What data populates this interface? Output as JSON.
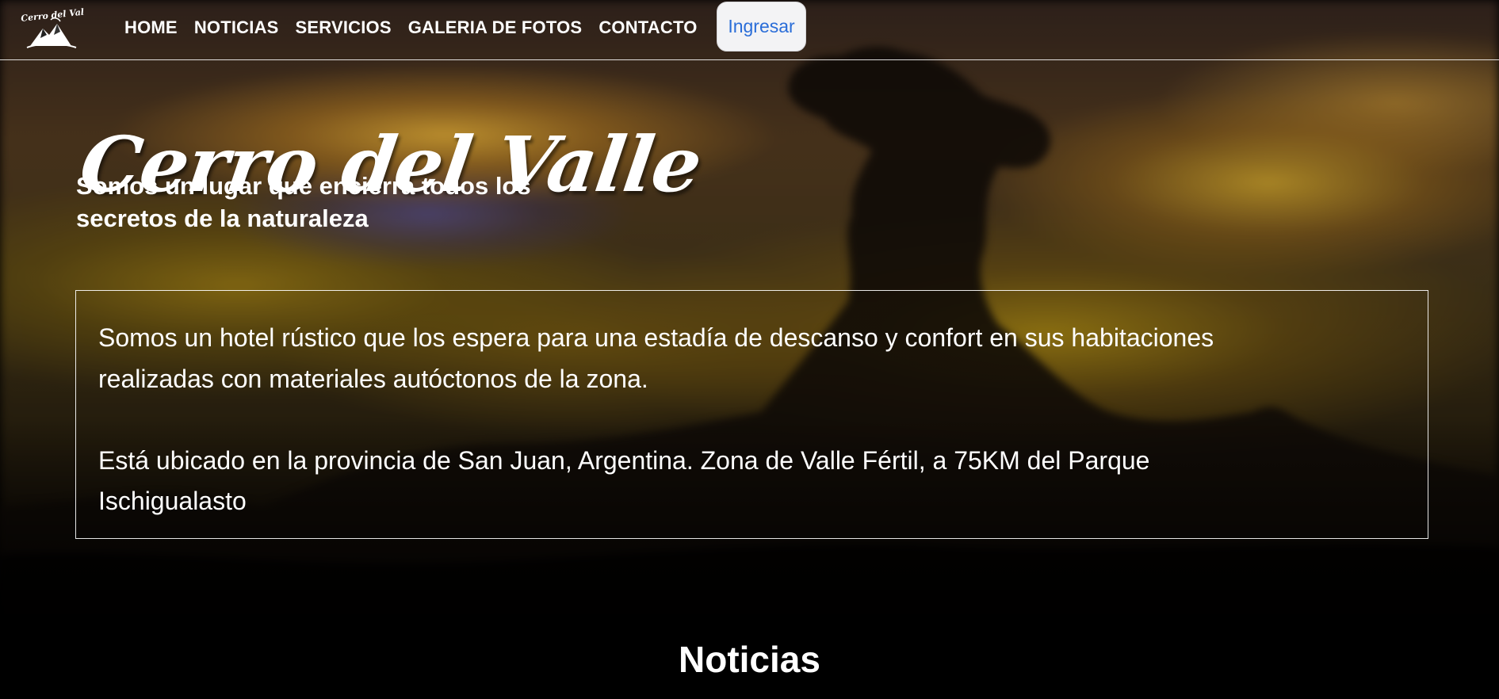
{
  "brand": {
    "logo_text": "Cerro del Valle",
    "logo_icon": "mountain-logo-icon"
  },
  "nav": {
    "items": [
      {
        "label": "HOME"
      },
      {
        "label": "NOTICIAS"
      },
      {
        "label": "SERVICIOS"
      },
      {
        "label": "GALERIA DE FOTOS"
      },
      {
        "label": "CONTACTO"
      }
    ],
    "login_label": "Ingresar"
  },
  "hero": {
    "title": "Cerro del Valle",
    "subtitle": "Somos un lugar que encierra todos los secretos de la naturaleza"
  },
  "info": {
    "paragraph_1": "Somos un hotel rústico que los espera para una estadía de descanso y confort en sus habitaciones realizadas con materiales autóctonos de la zona.",
    "paragraph_2": "Está ubicado en la provincia de San Juan, Argentina. Zona de Valle Fértil, a 75KM del Parque Ischigualasto"
  },
  "news": {
    "heading": "Noticias"
  },
  "colors": {
    "nav_text": "#ffffff",
    "login_bg": "#f3f3f5",
    "login_text": "#2a6dd8",
    "page_bg": "#000000"
  }
}
